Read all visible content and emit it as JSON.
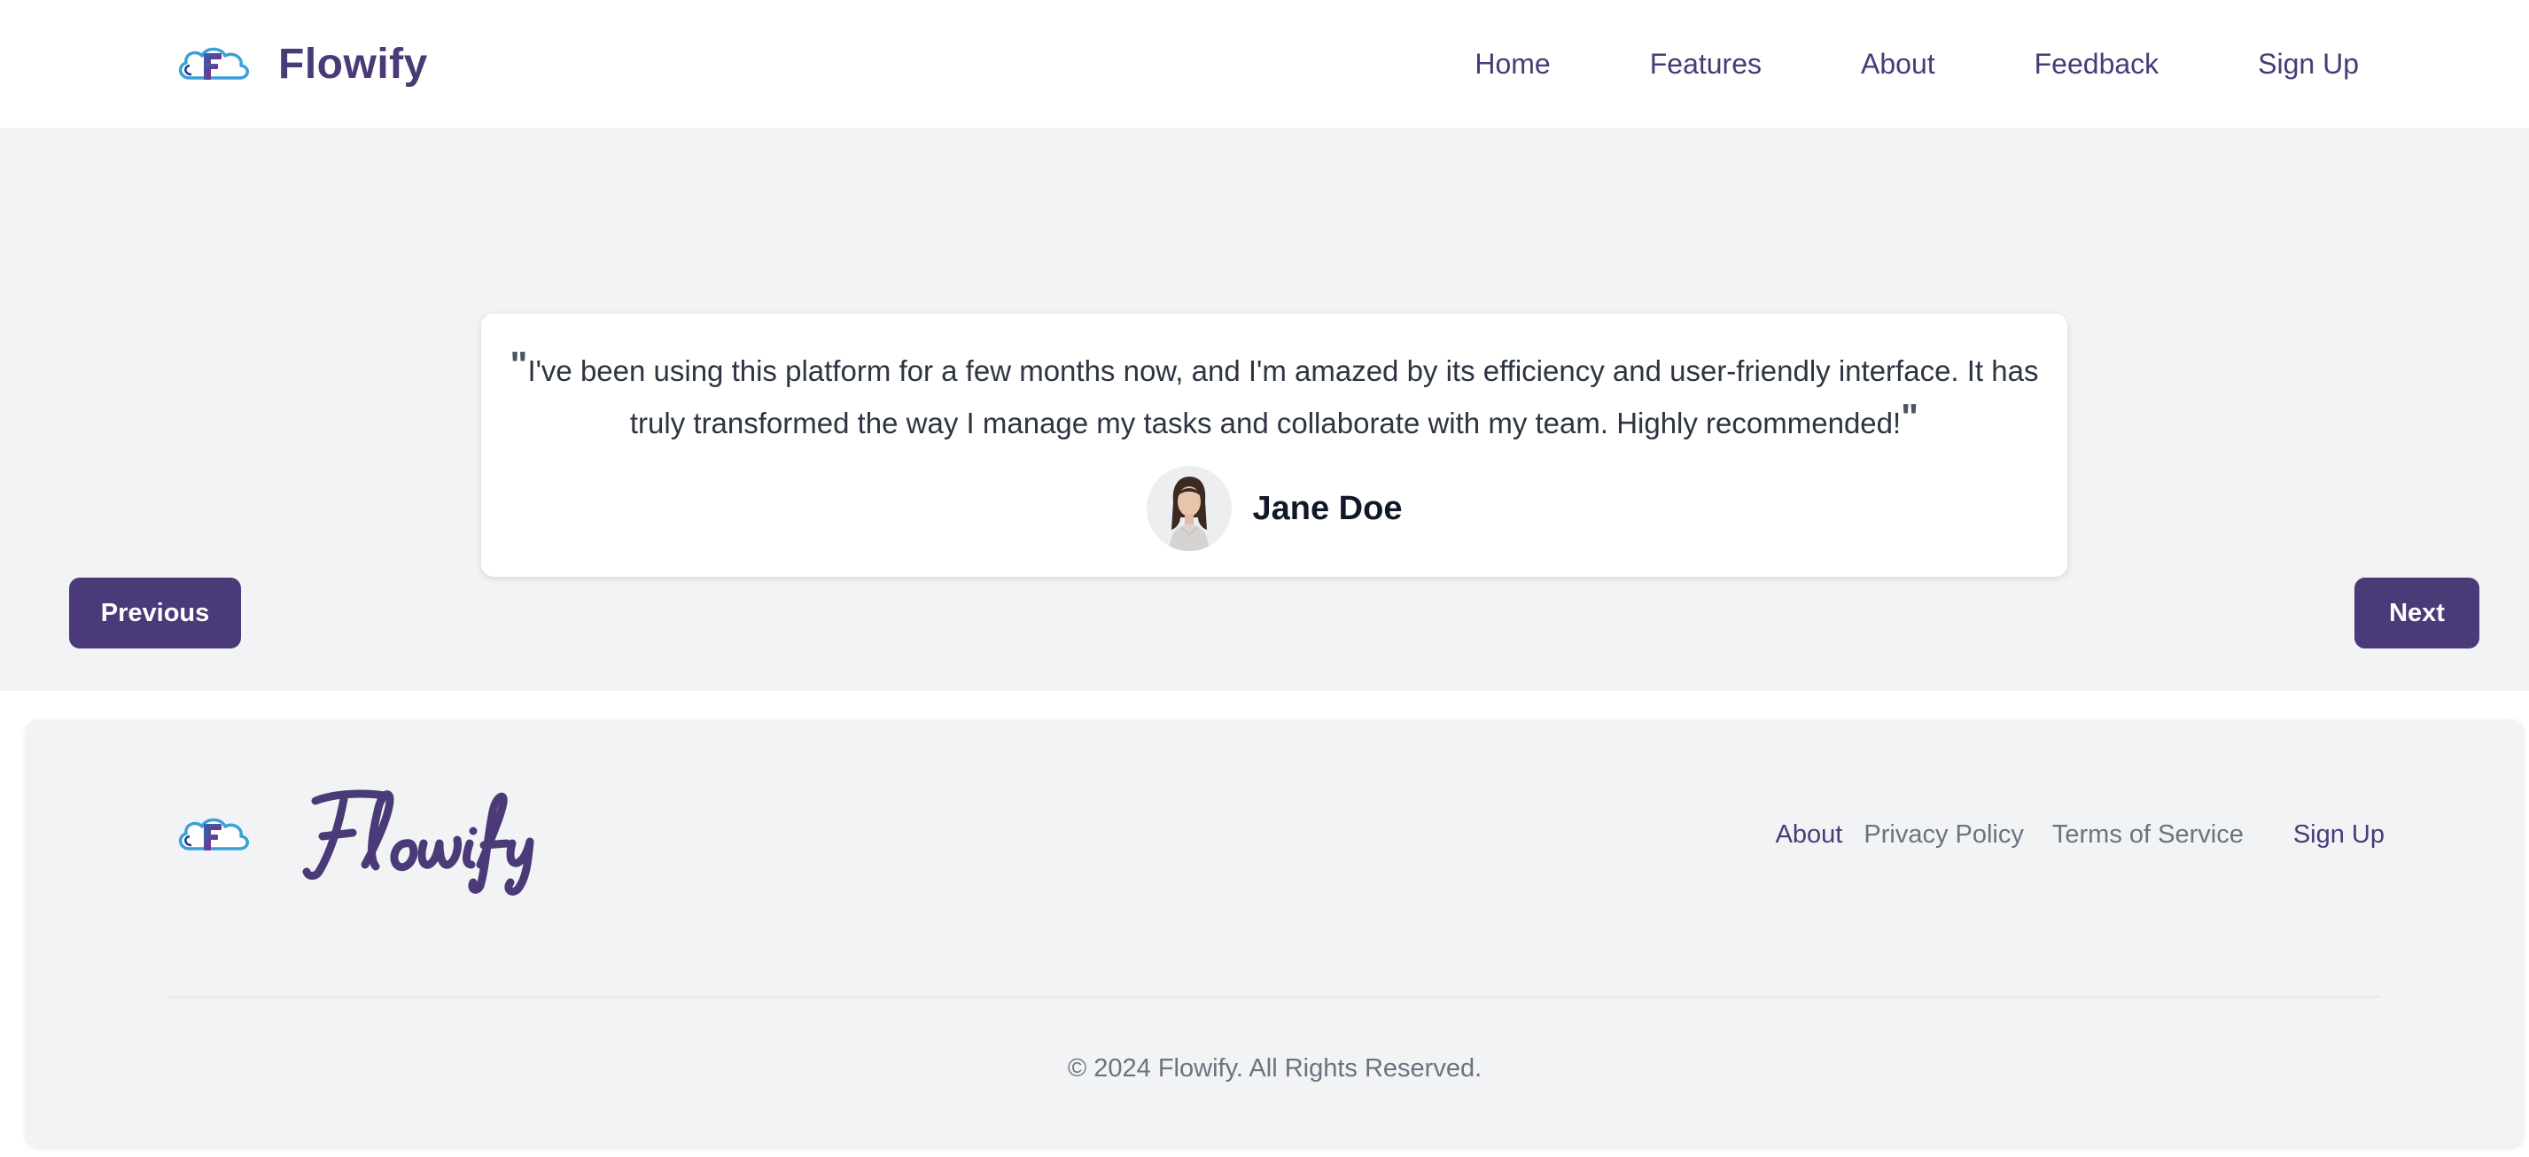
{
  "header": {
    "brand_name": "Flowify",
    "nav": [
      {
        "label": "Home"
      },
      {
        "label": "Features"
      },
      {
        "label": "About"
      },
      {
        "label": "Feedback"
      },
      {
        "label": "Sign Up"
      }
    ]
  },
  "testimonial": {
    "quote": "I've been using this platform for a few months now, and I'm amazed by its efficiency and user-friendly interface. It has truly transformed the way I manage my tasks and collaborate with my team. Highly recommended!",
    "open_quote_mark": "\"",
    "close_quote_mark": "\"",
    "author_name": "Jane Doe",
    "avatar_icon": "user-avatar-photo"
  },
  "controls": {
    "previous_label": "Previous",
    "next_label": "Next"
  },
  "footer": {
    "wordmark": "Flowify",
    "links": [
      {
        "label": "About"
      },
      {
        "label": "Privacy Policy"
      },
      {
        "label": "Terms of Service"
      },
      {
        "label": "Sign Up"
      }
    ],
    "copyright": "© 2024 Flowify. All Rights Reserved."
  },
  "colors": {
    "brand": "#4a3a78",
    "page_bg": "#f2f3f5",
    "card_bg": "#ffffff",
    "muted_text": "#6b7280",
    "logo_blue": "#3aa0d8",
    "logo_purple": "#7a2a8f"
  },
  "icons": {
    "logo": "cloud-f-logo-icon"
  }
}
